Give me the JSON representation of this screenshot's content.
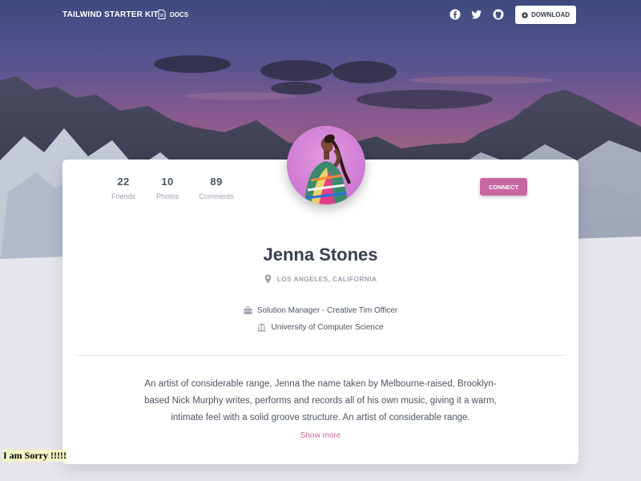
{
  "navbar": {
    "brand": "TAILWIND STARTER KIT",
    "docs_label": "DOCS",
    "social_icons": [
      "facebook-icon",
      "twitter-icon",
      "github-icon"
    ],
    "download_label": "DOWNLOAD"
  },
  "profile": {
    "stats": [
      {
        "value": "22",
        "label": "Friends"
      },
      {
        "value": "10",
        "label": "Photos"
      },
      {
        "value": "89",
        "label": "Comments"
      }
    ],
    "connect_label": "CONNECT",
    "name": "Jenna Stones",
    "location": "LOS ANGELES, CALIFORNIA",
    "job": "Solution Manager - Creative Tim Officer",
    "education": "University of Computer Science",
    "bio": "An artist of considerable range, Jenna the name taken by Melbourne-raised, Brooklyn-based Nick Murphy writes, performs and records all of his own music, giving it a warm, intimate feel with a solid groove structure. An artist of considerable range.",
    "show_more": "Show more"
  },
  "overlay_text": "I am Sorry !!!!!",
  "colors": {
    "accent": "#c967a3",
    "page_bg": "#e5e7eb",
    "text_dark": "#374151",
    "text_muted": "#9ca3af"
  }
}
